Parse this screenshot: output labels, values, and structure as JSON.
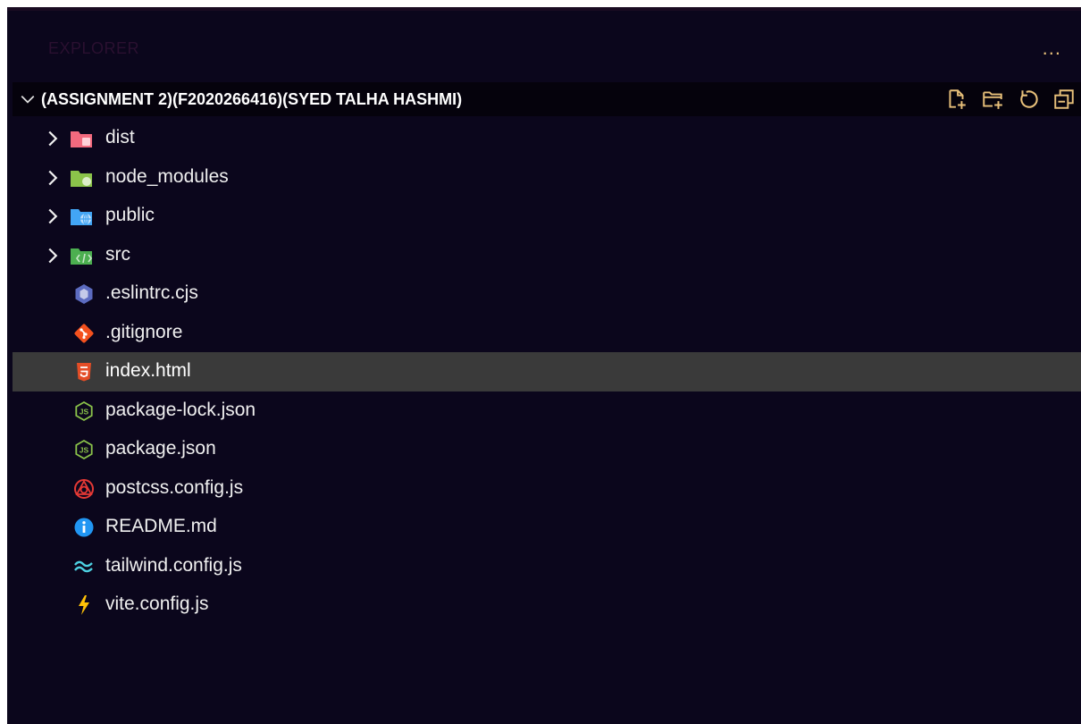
{
  "explorer": {
    "title": "EXPLORER",
    "more_label": "...",
    "folder_title": "(ASSIGNMENT 2)(F2020266416)(SYED TALHA HASHMI)",
    "header_actions": [
      "new-file-icon",
      "new-folder-icon",
      "refresh-icon",
      "collapse-all-icon"
    ],
    "selected_item": "index.html"
  },
  "tree": {
    "folders": [
      {
        "label": "dist",
        "icon": "dist-folder-icon",
        "color": "#f26a7e"
      },
      {
        "label": "node_modules",
        "icon": "node-modules-folder-icon",
        "color": "#8bc34a"
      },
      {
        "label": "public",
        "icon": "public-folder-icon",
        "color": "#42a5f5"
      },
      {
        "label": "src",
        "icon": "src-folder-icon",
        "color": "#4caf50"
      }
    ],
    "files": [
      {
        "label": ".eslintrc.cjs",
        "icon": "eslint-icon",
        "color": "#5c6bc0"
      },
      {
        "label": ".gitignore",
        "icon": "git-icon",
        "color": "#f4511e"
      },
      {
        "label": "index.html",
        "icon": "html-icon",
        "color": "#e44d26"
      },
      {
        "label": "package-lock.json",
        "icon": "nodejs-icon",
        "color": "#8bc34a"
      },
      {
        "label": "package.json",
        "icon": "nodejs-icon",
        "color": "#8bc34a"
      },
      {
        "label": "postcss.config.js",
        "icon": "postcss-icon",
        "color": "#e53935"
      },
      {
        "label": "README.md",
        "icon": "info-icon",
        "color": "#2196f3"
      },
      {
        "label": "tailwind.config.js",
        "icon": "tailwind-icon",
        "color": "#4dd0e1"
      },
      {
        "label": "vite.config.js",
        "icon": "vite-icon",
        "color": "#ffc107"
      }
    ]
  },
  "colors": {
    "background": "#0b061c",
    "header_background": "#05020c",
    "selected_row": "#3a3a3a",
    "accent": "#e8c07a",
    "text": "#f0f0f0"
  }
}
